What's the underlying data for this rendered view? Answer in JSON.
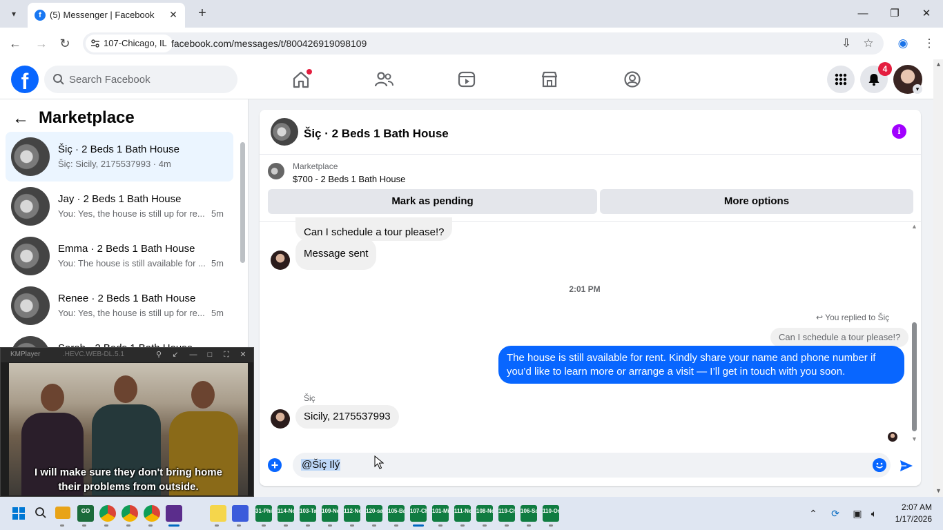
{
  "browser": {
    "tab_title": "(5) Messenger | Facebook",
    "site_chip": "107-Chicago, IL",
    "url": "facebook.com/messages/t/800426919098109"
  },
  "header": {
    "search_placeholder": "Search Facebook",
    "notification_count": "4"
  },
  "sidebar": {
    "title": "Marketplace",
    "conversations": [
      {
        "name": "Šiç · 2 Beds 1 Bath House",
        "preview": "Šiç: Sicily, 2175537993 · 4m",
        "time": ""
      },
      {
        "name": "Jay · 2 Beds 1 Bath House",
        "preview": "You: Yes, the house is still up for re...",
        "time": "5m"
      },
      {
        "name": "Emma · 2 Beds 1 Bath House",
        "preview": "You: The house is still available for ...",
        "time": "5m"
      },
      {
        "name": "Renee · 2 Beds 1 Bath House",
        "preview": "You: Yes, the house is still up for re...",
        "time": "5m"
      },
      {
        "name": "Sarah · 2 Beds 1 Bath House",
        "preview": "",
        "time": ""
      }
    ]
  },
  "chat": {
    "title": "Šiç · 2 Beds 1 Bath House",
    "listing_label": "Marketplace",
    "listing_title": "$700 - 2 Beds 1 Bath House",
    "mark_pending": "Mark as pending",
    "more_options": "More options",
    "messages": {
      "m1": "Can I schedule a tour please!?",
      "m2": "Message sent",
      "timestamp": "2:01 PM",
      "replied_label": "You replied to Šiç",
      "replied_quote": "Can I schedule a tour please!?",
      "out": "The house is still available for rent. Kindly share your name and phone number if you’d like to learn more or arrange a visit — I’ll get in touch with you soon.",
      "sender": "Šiç",
      "in_last": "Sicily, 2175537993"
    },
    "composer_text": "@Šiç Ilý"
  },
  "kmplayer": {
    "title": "KMPlayer",
    "file": ".HEVC.WEB-DL.5.1",
    "subtitle_line1": "I will make sure they don't bring home",
    "subtitle_line2": "their problems from outside."
  },
  "taskbar": {
    "apps": [
      "31-Phil",
      "114-Ne",
      "103-Ta",
      "109-Ne",
      "112-Ne",
      "120-sal",
      "105-Bal",
      "107-Chi",
      "101-Mil",
      "111-Ne",
      "108-Ne",
      "119-Ch",
      "106-Sal",
      "110-Orl"
    ],
    "time": "2:07 AM",
    "date": "1/17/2026"
  },
  "colors": {
    "facebook_blue": "#0866ff",
    "notification_red": "#e41e3f",
    "info_purple": "#a100ff",
    "excel_green": "#107c41"
  }
}
